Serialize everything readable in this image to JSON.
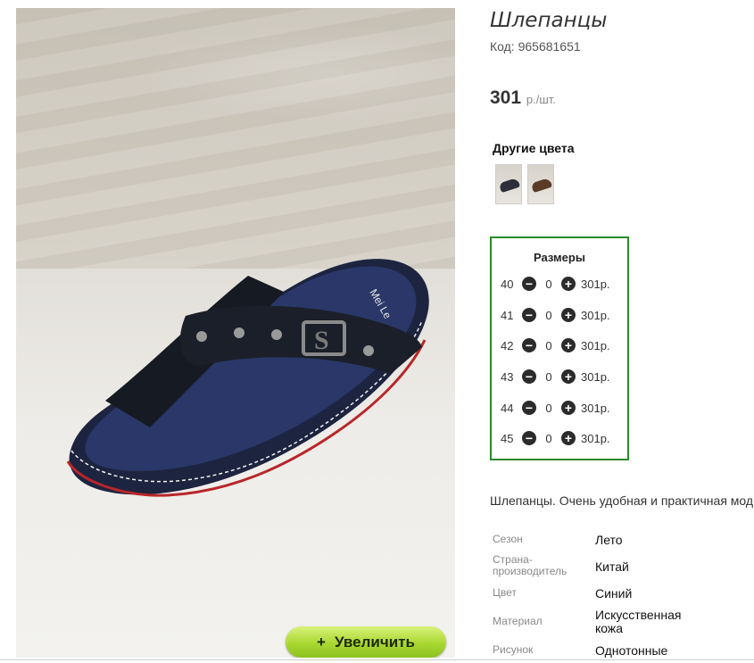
{
  "product": {
    "title": "Шлепанцы",
    "code_label": "Код: 965681651",
    "price": "301",
    "price_unit": "р./шт."
  },
  "photo": {
    "zoom_button_icon": "plus-icon",
    "zoom_button_label": "Увеличить",
    "brand_on_strap": "Mei Le"
  },
  "other_colors": {
    "label": "Другие цвета",
    "swatches": [
      "dark-navy",
      "brown"
    ]
  },
  "sizes": {
    "title": "Размеры",
    "rows": [
      {
        "size": "40",
        "qty": "0",
        "price": "301р."
      },
      {
        "size": "41",
        "qty": "0",
        "price": "301р."
      },
      {
        "size": "42",
        "qty": "0",
        "price": "301р."
      },
      {
        "size": "43",
        "qty": "0",
        "price": "301р."
      },
      {
        "size": "44",
        "qty": "0",
        "price": "301р."
      },
      {
        "size": "45",
        "qty": "0",
        "price": "301р."
      }
    ]
  },
  "description": "Шлепанцы. Очень удобная и практичная мод",
  "properties": [
    {
      "key": "Сезон",
      "value": "Лето"
    },
    {
      "key": "Страна-производитель",
      "value": "Китай"
    },
    {
      "key": "Цвет",
      "value": "Синий"
    },
    {
      "key": "Материал",
      "value": "Искусственная кожа"
    },
    {
      "key": "Рисунок",
      "value": "Однотонные"
    }
  ],
  "colors": {
    "accent_green": "#2a8a2a",
    "zoom_button": "#a9d832"
  }
}
